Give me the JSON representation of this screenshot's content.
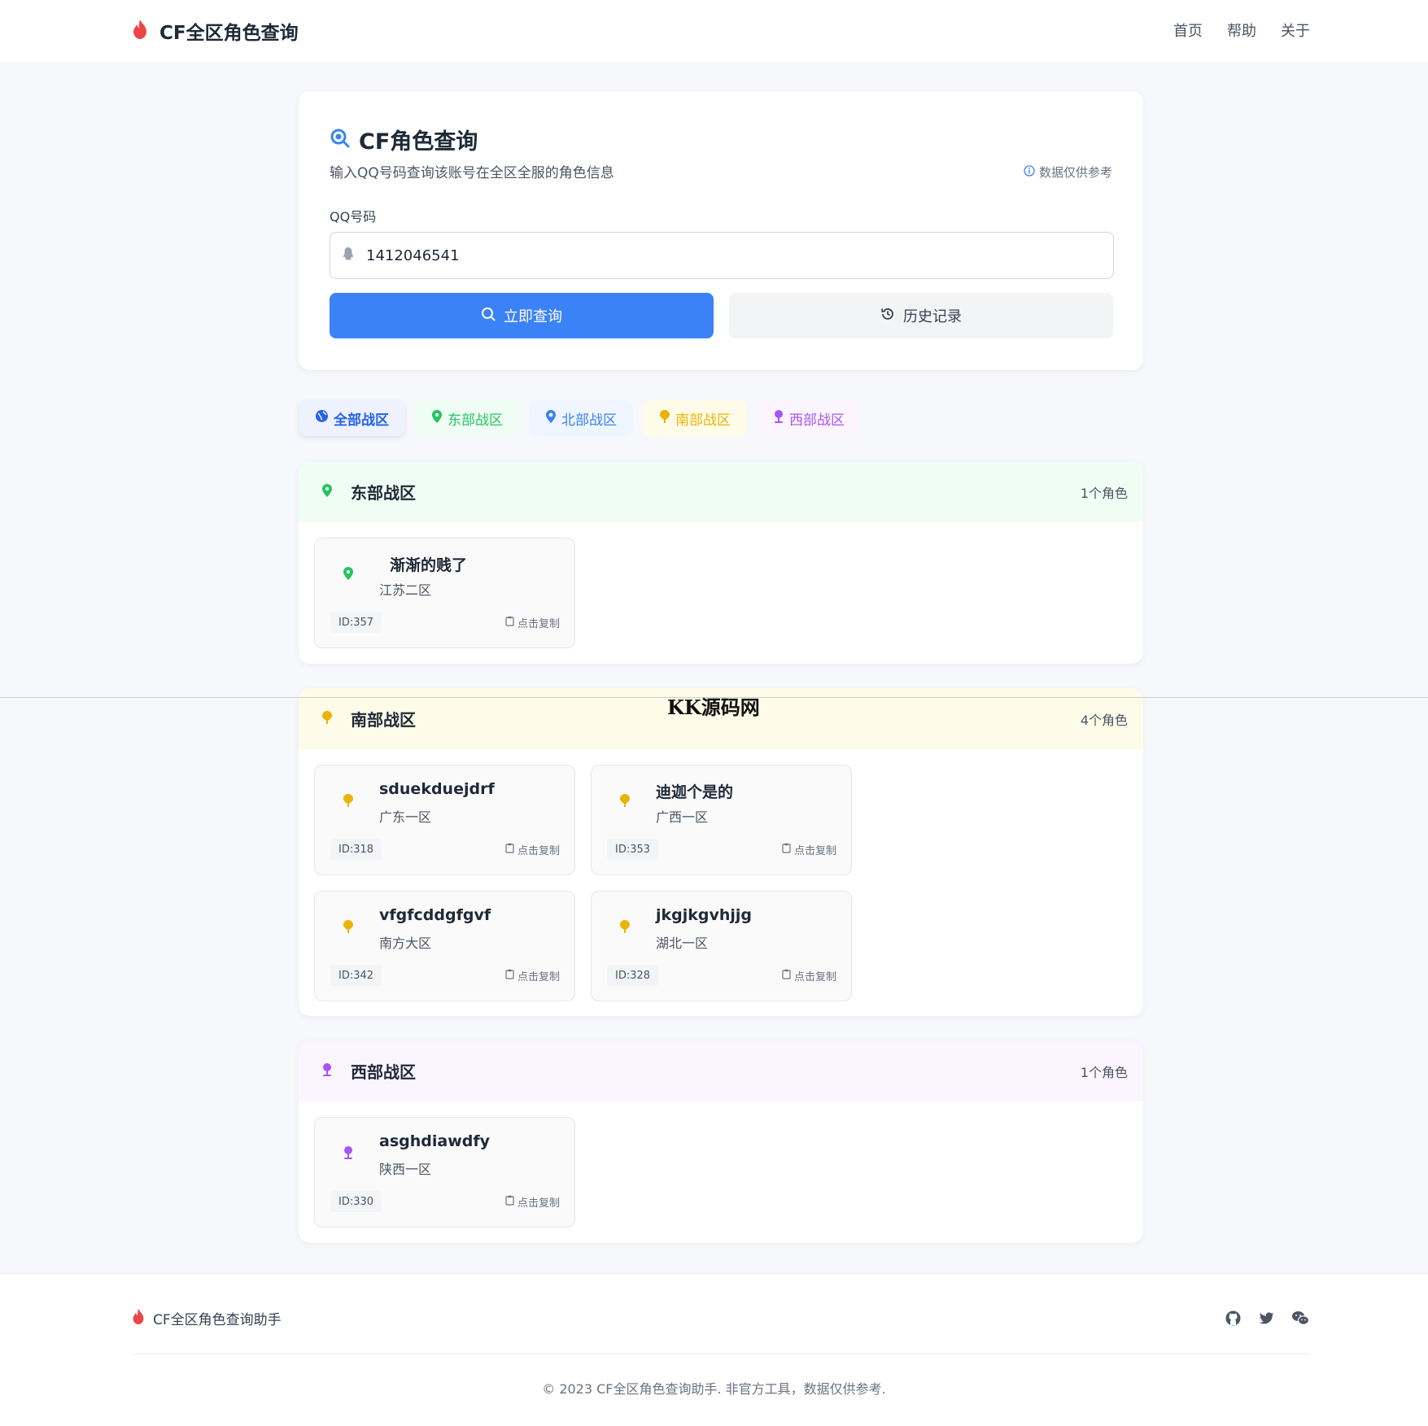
{
  "header": {
    "brand": "CF全区角色查询",
    "nav": [
      "首页",
      "帮助",
      "关于"
    ]
  },
  "query": {
    "title": "CF角色查询",
    "subtitle": "输入QQ号码查询该账号在全区全服的角色信息",
    "note": "数据仅供参考",
    "label": "QQ号码",
    "qq_value": "1412046541",
    "search_button": "立即查询",
    "history_button": "历史记录"
  },
  "tabs": [
    "全部战区",
    "东部战区",
    "北部战区",
    "南部战区",
    "西部战区"
  ],
  "sections": {
    "east": {
      "title": "东部战区",
      "count": "1个角色",
      "roles": [
        {
          "name": "渐渐的贱了",
          "zone": "江苏二区",
          "id": "ID:357",
          "copy": "点击复制"
        }
      ]
    },
    "south": {
      "title": "南部战区",
      "count": "4个角色",
      "roles": [
        {
          "name": "sduekduejdrf",
          "zone": "广东一区",
          "id": "ID:318",
          "copy": "点击复制"
        },
        {
          "name": "迪迦个是的",
          "zone": "广西一区",
          "id": "ID:353",
          "copy": "点击复制"
        },
        {
          "name": "vfgfcddgfgvf",
          "zone": "南方大区",
          "id": "ID:342",
          "copy": "点击复制"
        },
        {
          "name": "jkgjkgvhjjg",
          "zone": "湖北一区",
          "id": "ID:328",
          "copy": "点击复制"
        }
      ]
    },
    "west": {
      "title": "西部战区",
      "count": "1个角色",
      "roles": [
        {
          "name": "asghdiawdfy",
          "zone": "陕西一区",
          "id": "ID:330",
          "copy": "点击复制"
        }
      ]
    }
  },
  "watermark": "KK源码网",
  "footer": {
    "brand": "CF全区角色查询助手",
    "copyright": "© 2023 CF全区角色查询助手. 非官方工具，数据仅供参考."
  },
  "colors": {
    "primary": "#3b82f6",
    "east": "#22c55e",
    "north": "#3b82f6",
    "south": "#eab308",
    "west": "#a855f7",
    "flame": "#ef4444"
  },
  "icons": [
    "flame-icon",
    "search-icon",
    "info-icon",
    "qq-icon",
    "history-icon",
    "globe-icon",
    "map-pin-icon",
    "clipboard-icon",
    "github-icon",
    "twitter-icon",
    "wechat-icon"
  ]
}
